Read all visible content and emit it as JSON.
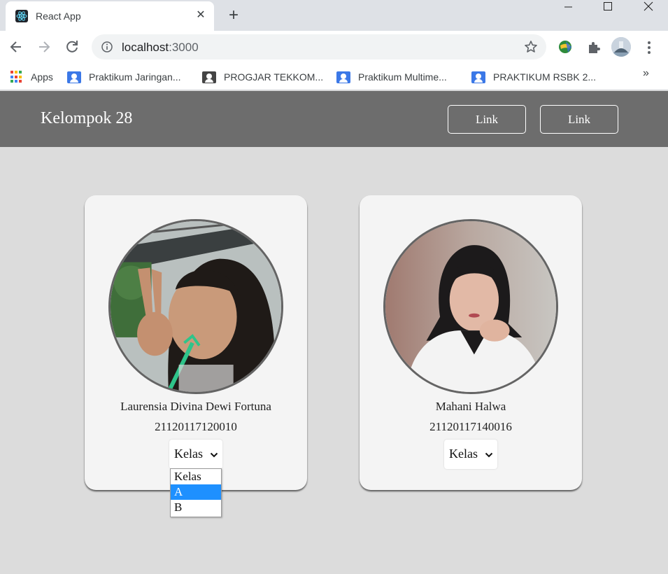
{
  "browser": {
    "tab_title": "React App",
    "url_host": "localhost",
    "url_port": ":3000",
    "bookmarks": [
      {
        "label": "Apps",
        "icon": "apps-grid-icon"
      },
      {
        "label": "Praktikum Jaringan...",
        "icon": "classroom-icon"
      },
      {
        "label": "PROGJAR TEKKOM...",
        "icon": "classroom-icon"
      },
      {
        "label": "Praktikum Multime...",
        "icon": "classroom-icon"
      },
      {
        "label": "PRAKTIKUM RSBK 2...",
        "icon": "classroom-icon"
      }
    ],
    "bookmarks_overflow": "»"
  },
  "navbar": {
    "brand": "Kelompok 28",
    "links": [
      "Link",
      "Link"
    ]
  },
  "members": [
    {
      "name": "Laurensia Divina Dewi Fortuna",
      "nim": "21120117120010",
      "select_value": "Kelas"
    },
    {
      "name": "Mahani Halwa",
      "nim": "21120117140016",
      "select_value": "Kelas"
    }
  ],
  "dropdown": {
    "options": [
      "Kelas",
      "A",
      "B"
    ],
    "highlighted": "A"
  },
  "colors": {
    "navbar_bg": "#6d6d6d",
    "page_bg": "#dcdcdc",
    "card_bg": "#f4f4f4",
    "highlight": "#1e90ff"
  }
}
